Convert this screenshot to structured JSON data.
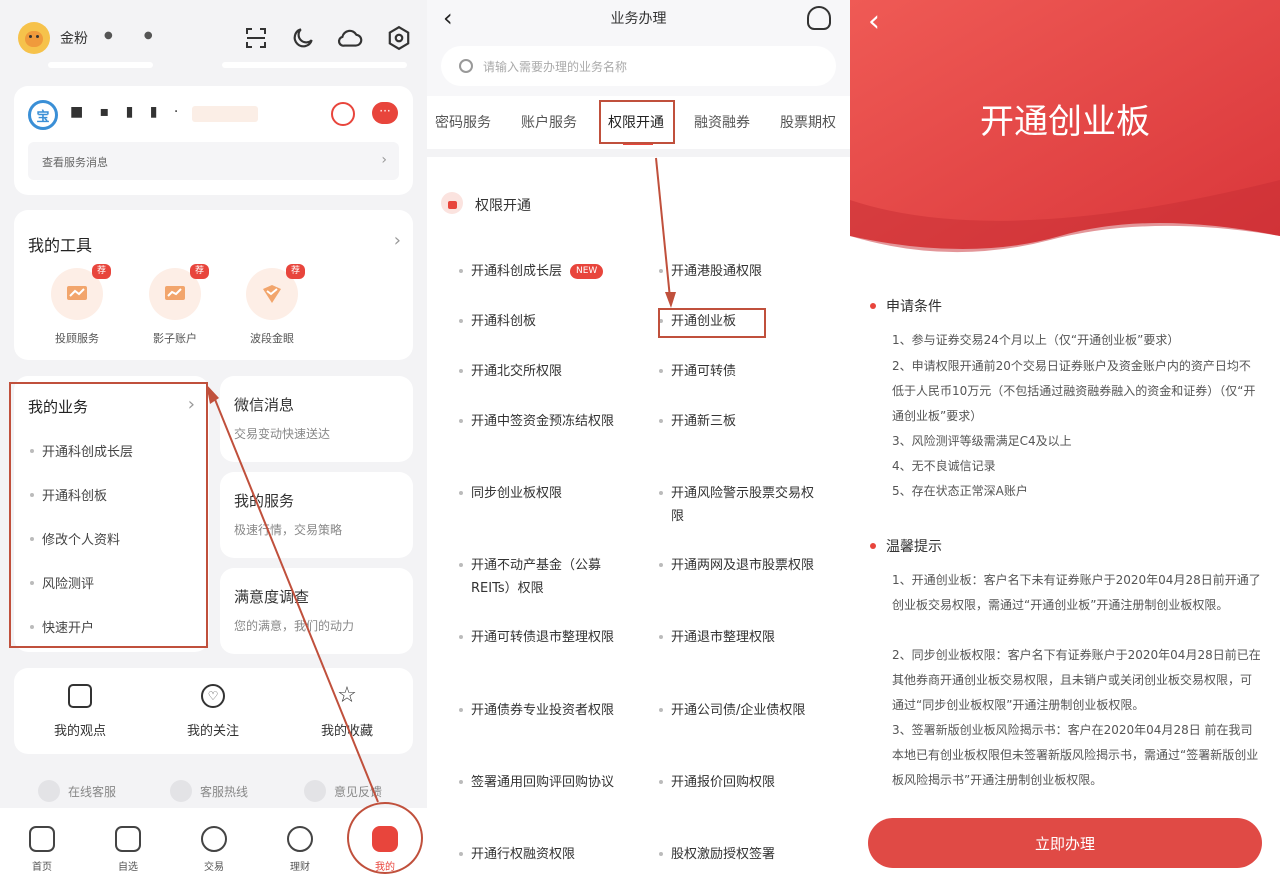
{
  "left": {
    "user_name": "金粉",
    "user_blur": "● ●",
    "account_blur": "■ ▪ ▮ ▮ ·",
    "service_msg": "查看服务消息",
    "tools_title": "我的工具",
    "tools": [
      {
        "label": "投顾服务",
        "badge": "荐",
        "icon": "advisor-chart-icon"
      },
      {
        "label": "影子账户",
        "badge": "荐",
        "icon": "shadow-account-icon"
      },
      {
        "label": "波段金眼",
        "badge": "荐",
        "icon": "wave-eye-icon"
      }
    ],
    "biz_title": "我的业务",
    "biz_items": [
      "开通科创成长层",
      "开通科创板",
      "修改个人资料",
      "风险测评",
      "快速开户"
    ],
    "cards": [
      {
        "title": "微信消息",
        "sub": "交易变动快速送达"
      },
      {
        "title": "我的服务",
        "sub": "极速行情，交易策略"
      },
      {
        "title": "满意度调查",
        "sub": "您的满意，我们的动力"
      }
    ],
    "shortcuts": [
      {
        "label": "我的观点",
        "icon": "opinion-icon"
      },
      {
        "label": "我的关注",
        "icon": "heart-icon"
      },
      {
        "label": "我的收藏",
        "icon": "star-icon"
      }
    ],
    "support": [
      "在线客服",
      "客服热线",
      "意见反馈"
    ],
    "nav": [
      "首页",
      "自选",
      "交易",
      "理财",
      "我的"
    ],
    "accent": "#e8453c"
  },
  "middle": {
    "title": "业务办理",
    "search_placeholder": "请输入需要办理的业务名称",
    "tabs": [
      "密码服务",
      "账户服务",
      "权限开通",
      "融资融券",
      "股票期权"
    ],
    "active_tab": "权限开通",
    "section_title": "权限开通",
    "new_badge": "NEW",
    "items": [
      [
        "开通科创成长层",
        "开通港股通权限"
      ],
      [
        "开通科创板",
        "开通创业板"
      ],
      [
        "开通北交所权限",
        "开通可转债"
      ],
      [
        "开通中签资金预冻结权限",
        "开通新三板"
      ],
      [
        "同步创业板权限",
        "开通风险警示股票交易权限"
      ],
      [
        "开通不动产基金（公募REITs）权限",
        "开通两网及退市股票权限"
      ],
      [
        "开通可转债退市整理权限",
        "开通退市整理权限"
      ],
      [
        "开通债券专业投资者权限",
        "开通公司债/企业债权限"
      ],
      [
        "签署通用回购评回购协议",
        "开通报价回购权限"
      ],
      [
        "开通行权融资权限",
        "股权激励授权签署"
      ]
    ]
  },
  "right": {
    "hero_title": "开通创业板",
    "cond_title": "申请条件",
    "conditions": [
      "1、参与证券交易24个月以上（仅“开通创业板”要求）",
      "2、申请权限开通前20个交易日证券账户及资金账户内的资产日均不低于人民币10万元（不包括通过融资融券融入的资金和证券）（仅“开通创业板”要求）",
      "3、风险测评等级需满足C4及以上",
      "4、无不良诚信记录",
      "5、存在状态正常深A账户"
    ],
    "tips_title": "温馨提示",
    "tips": [
      "1、开通创业板：客户名下未有证券账户于2020年04月28日前开通了创业板交易权限，需通过“开通创业板”开通注册制创业板权限。",
      "2、同步创业板权限：客户名下有证券账户于2020年04月28日前已在其他券商开通创业板交易权限，且未销户或关闭创业板交易权限，可通过“同步创业板权限”开通注册制创业板权限。",
      "3、签署新版创业板风险揭示书：客户在2020年04月28日 前在我司本地已有创业板权限但未签署新版风险揭示书，需通过“签署新版创业板风险揭示书”开通注册制创业板权限。"
    ],
    "cta": "立即办理",
    "hero_color": "#e04a45"
  }
}
